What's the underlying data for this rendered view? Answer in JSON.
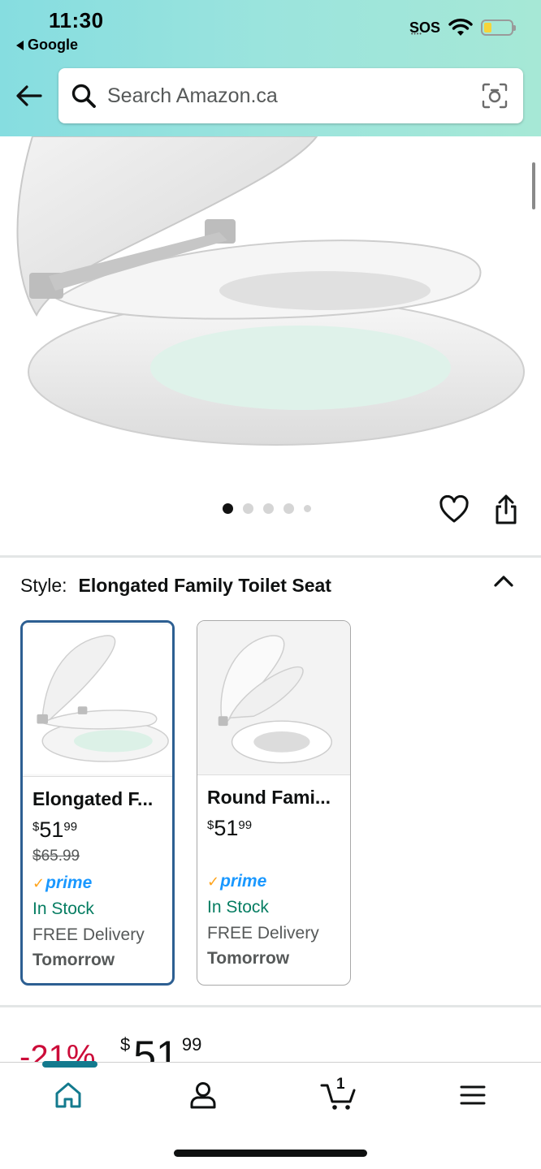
{
  "status_bar": {
    "time": "11:30",
    "back_app": "Google",
    "sos": "SOS",
    "battery_color": "#f6d43a"
  },
  "header": {
    "search_placeholder": "Search Amazon.ca",
    "gradient_colors": [
      "#86dde0",
      "#a6e8d6"
    ]
  },
  "gallery": {
    "image_count": 5,
    "active_index": 0
  },
  "style_selector": {
    "label": "Style:",
    "value": "Elongated Family Toilet Seat",
    "options": [
      {
        "title": "Elongated F...",
        "price_currency": "$",
        "price_whole": "51",
        "price_fraction": "99",
        "list_price": "$65.99",
        "prime": "prime",
        "stock": "In Stock",
        "delivery": "FREE Delivery",
        "delivery_day": "Tomorrow",
        "selected": true
      },
      {
        "title": "Round Fami...",
        "price_currency": "$",
        "price_whole": "51",
        "price_fraction": "99",
        "list_price": "",
        "prime": "prime",
        "stock": "In Stock",
        "delivery": "FREE Delivery",
        "delivery_day": "Tomorrow",
        "selected": false
      }
    ]
  },
  "price_block": {
    "discount": "-21%",
    "currency": "$",
    "whole": "51",
    "fraction": "99"
  },
  "bottom_nav": {
    "items": [
      "home-icon",
      "account-icon",
      "cart-icon",
      "menu-icon"
    ],
    "cart_count": "1",
    "active_color": "#137a8e"
  },
  "colors": {
    "accent_selected": "#2d5f92",
    "in_stock": "#067d62",
    "prime_blue": "#1a98ff",
    "discount_red": "#cc0c39"
  }
}
